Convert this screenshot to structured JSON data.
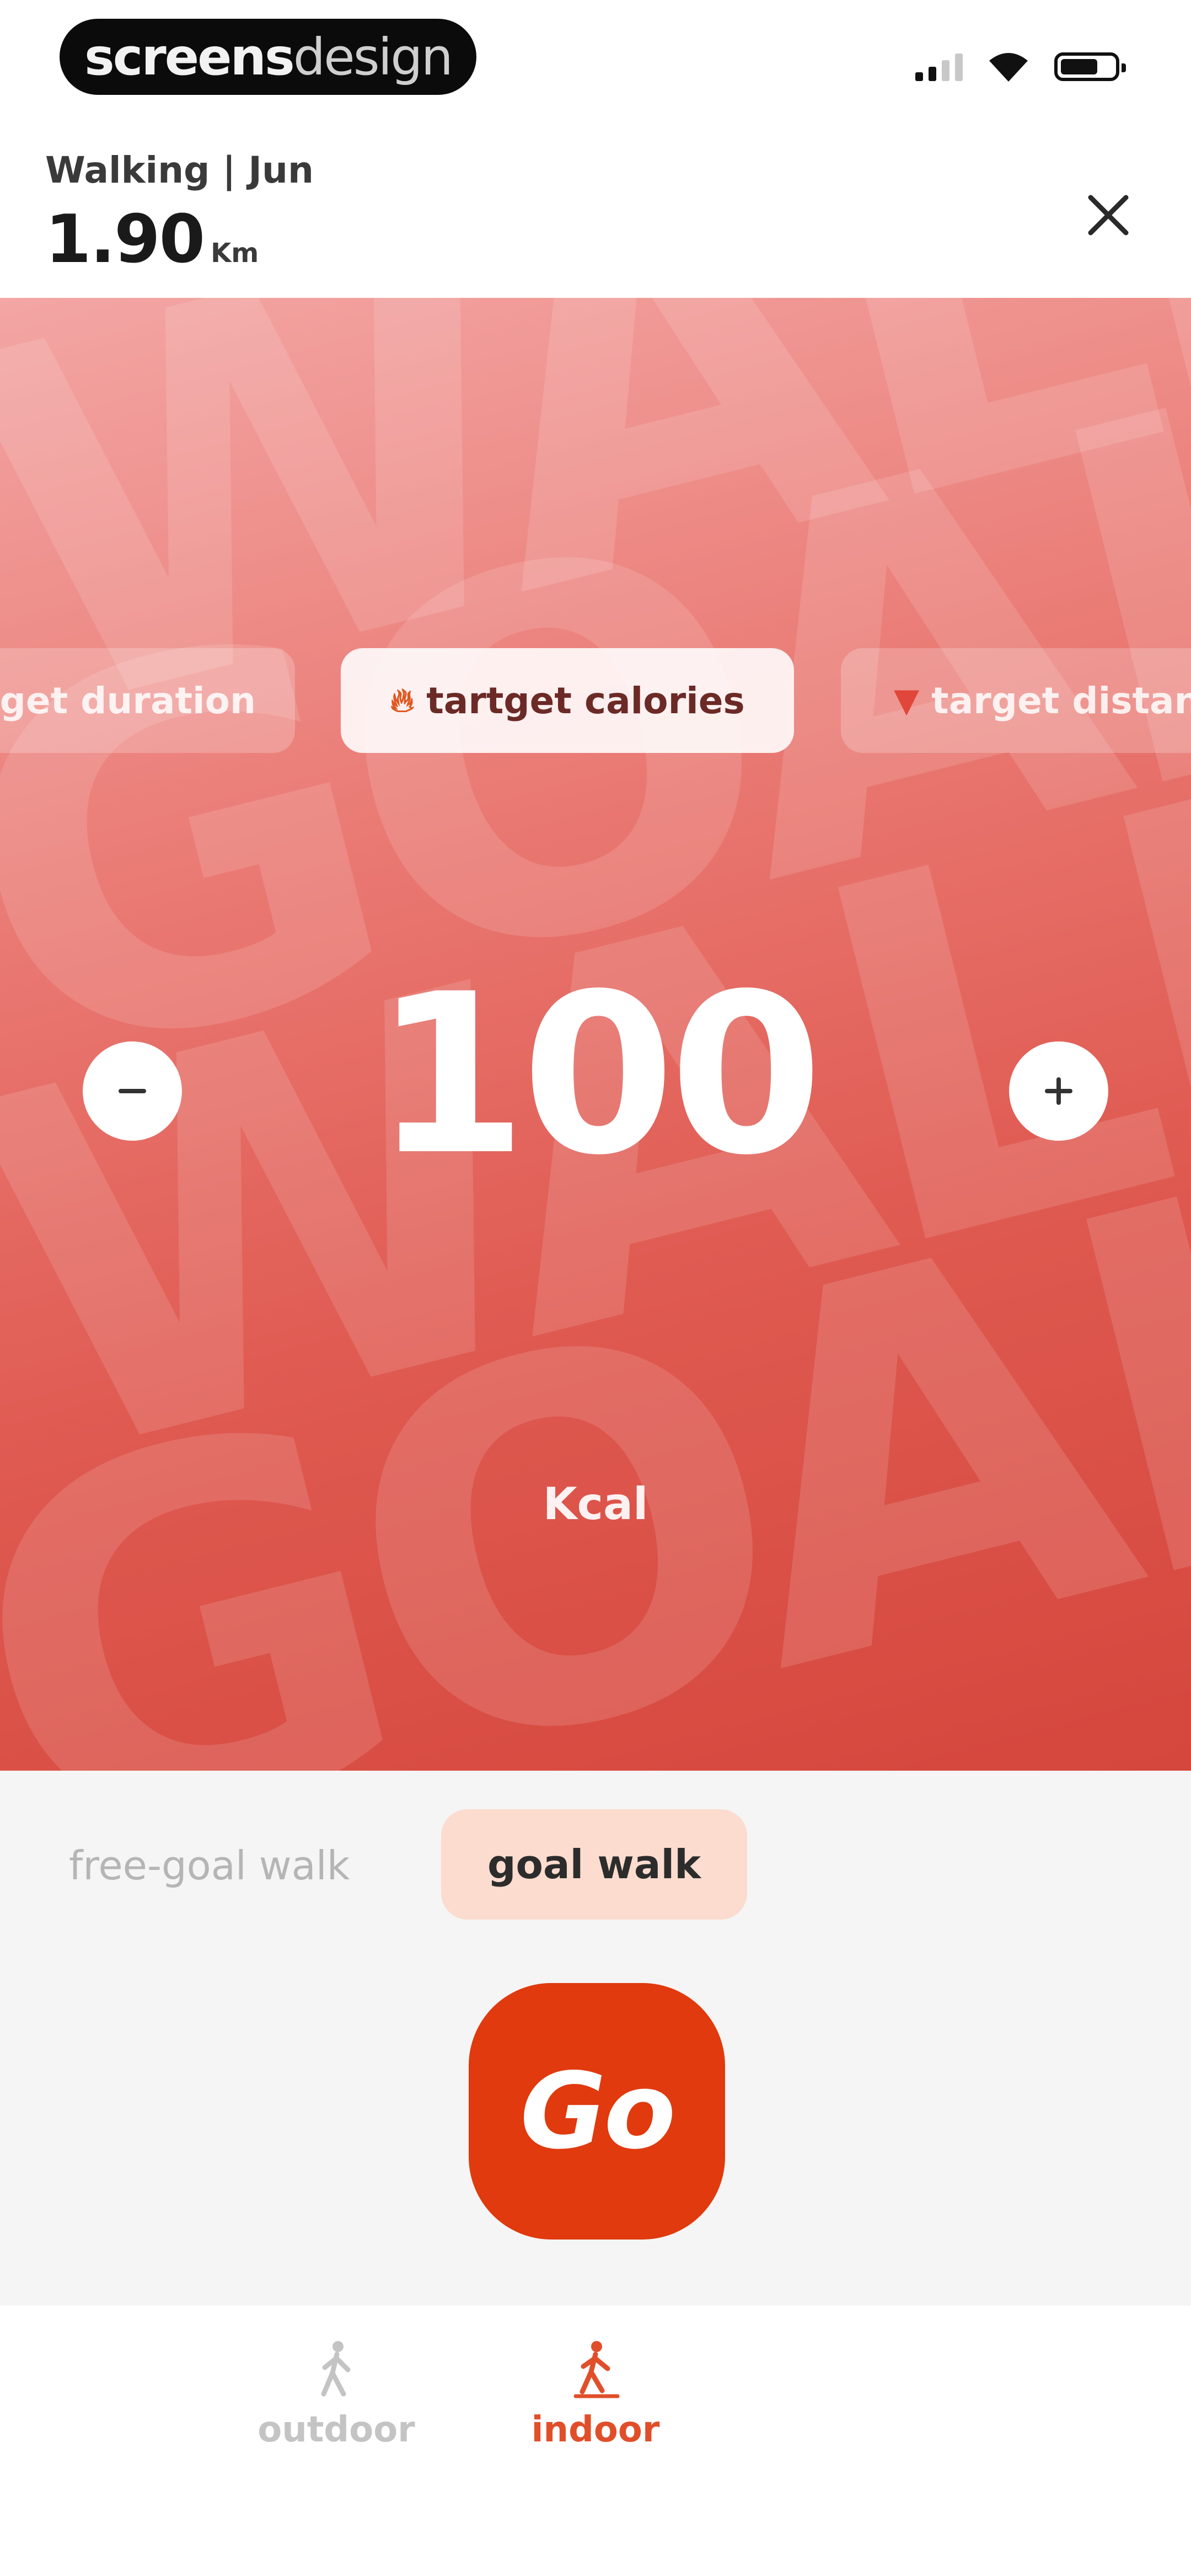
{
  "status_bar": {
    "brand_bold": "screens",
    "brand_light": "design",
    "signal_icon": "cellular-signal-icon",
    "wifi_icon": "wifi-icon",
    "battery_icon": "battery-icon"
  },
  "header": {
    "subtitle": "Walking | Jun",
    "distance_value": "1.90",
    "distance_unit": "Km",
    "close_icon": "close-icon"
  },
  "hero": {
    "background_words": [
      "WALK",
      "GOAL",
      "WALK",
      "GOAL"
    ],
    "gradient_top": "#f3a6a4",
    "gradient_bottom": "#d5463c",
    "chips": [
      {
        "label": "target duration",
        "icon": "clock-icon",
        "selected": false
      },
      {
        "label": "tartget calories",
        "icon": "flame-icon",
        "selected": true
      },
      {
        "label": "target distance",
        "icon": "location-pin-icon",
        "selected": false
      }
    ],
    "value": "100",
    "unit": "Kcal",
    "decrement_icon": "minus-icon",
    "increment_icon": "plus-icon"
  },
  "mode": {
    "options": [
      {
        "label": "free-goal walk",
        "selected": false
      },
      {
        "label": "goal walk",
        "selected": true
      }
    ],
    "go_label": "Go",
    "accent": "#e03a0e"
  },
  "tabbar": {
    "tabs": [
      {
        "label": "outdoor",
        "icon": "walking-person-icon",
        "active": false
      },
      {
        "label": "indoor",
        "icon": "treadmill-walker-icon",
        "active": true
      }
    ],
    "active_color": "#e04f2a"
  }
}
